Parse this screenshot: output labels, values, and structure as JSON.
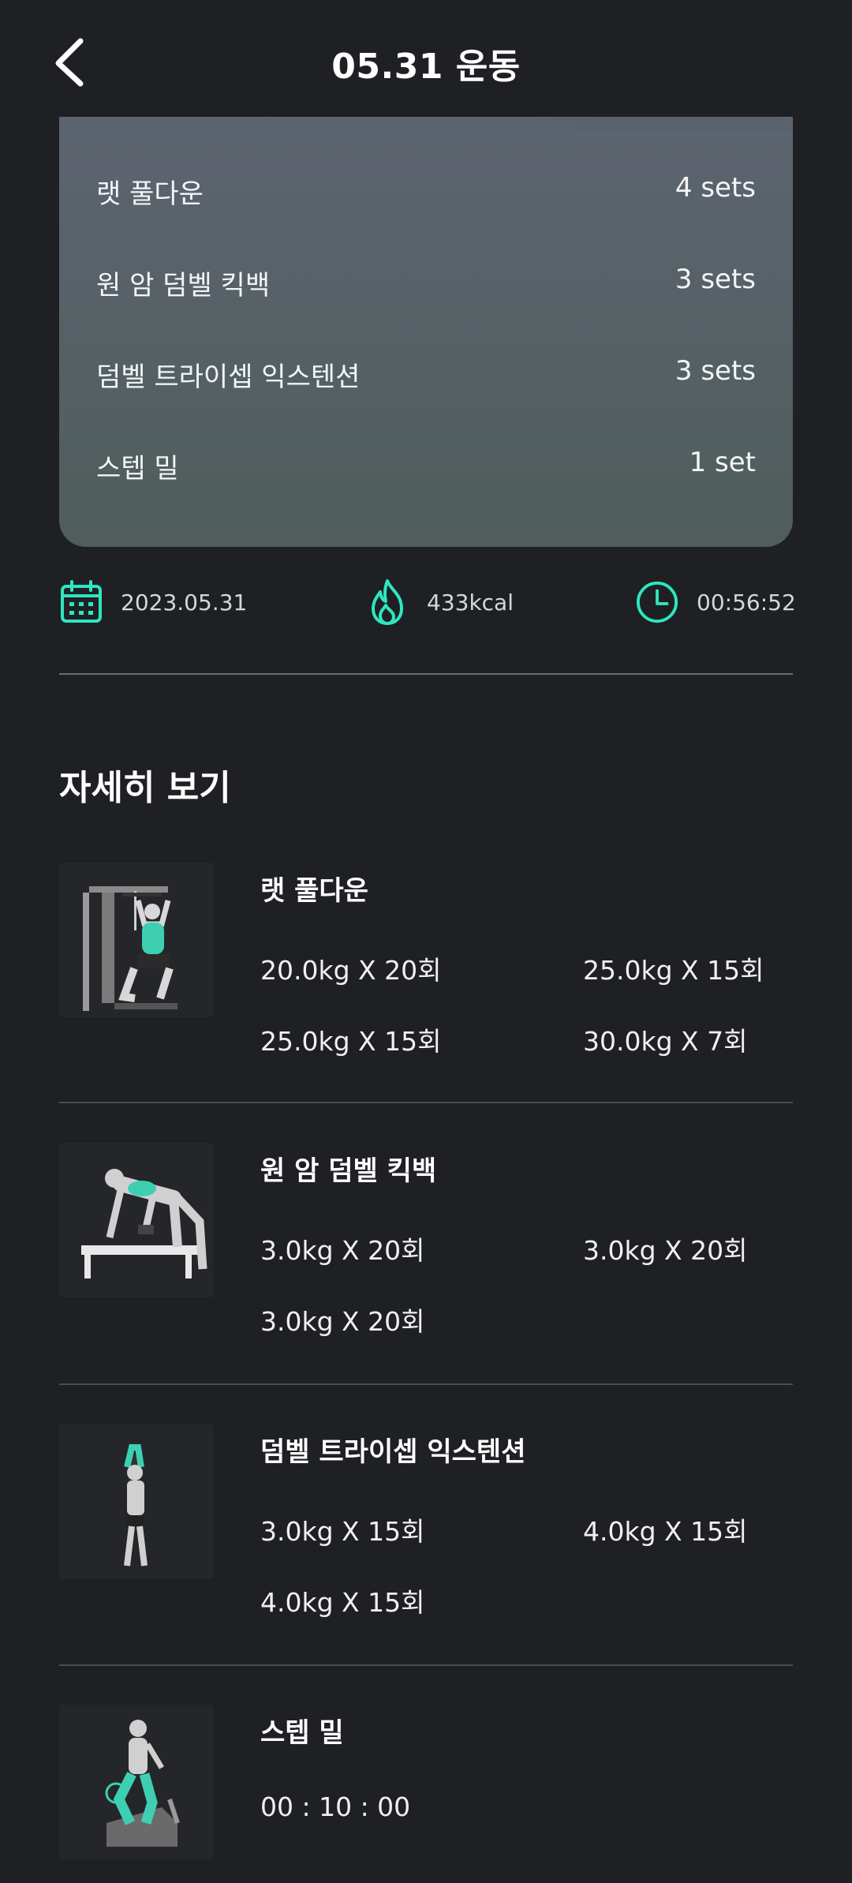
{
  "header": {
    "title": "05.31 운동",
    "back_icon": "chevron-left-icon"
  },
  "summary": [
    {
      "name": "랫 풀다운",
      "sets": "4 sets"
    },
    {
      "name": "원 암 덤벨 킥백",
      "sets": "3 sets"
    },
    {
      "name": "덤벨 트라이셉 익스텐션",
      "sets": "3 sets"
    },
    {
      "name": "스텝 밀",
      "sets": "1 set"
    }
  ],
  "stats": {
    "date": "2023.05.31",
    "calories": "433kcal",
    "duration": "00:56:52",
    "accent_color": "#2ee6c0"
  },
  "details_title": "자세히 보기",
  "details": [
    {
      "name": "랫 풀다운",
      "sets": [
        "20.0kg X 20회",
        "25.0kg X 15회",
        "25.0kg X 15회",
        "30.0kg X 7회"
      ]
    },
    {
      "name": "원 암 덤벨 킥백",
      "sets": [
        "3.0kg X 20회",
        "3.0kg X 20회",
        "3.0kg X 20회"
      ]
    },
    {
      "name": "덤벨 트라이셉 익스텐션",
      "sets": [
        "3.0kg X 15회",
        "4.0kg X 15회",
        "4.0kg X 15회"
      ]
    },
    {
      "name": "스텝 밀",
      "sets": [
        "00 : 10 : 00"
      ]
    }
  ]
}
